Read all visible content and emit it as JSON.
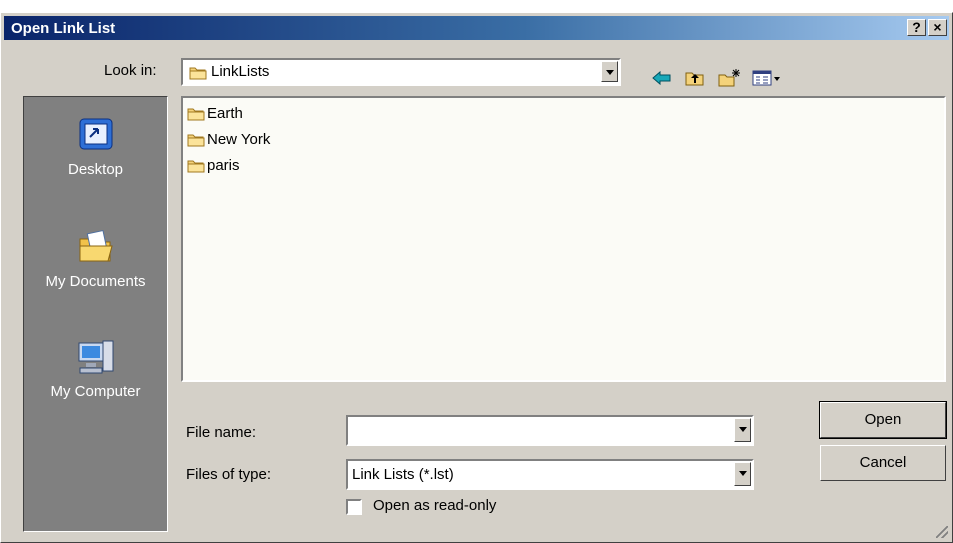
{
  "window": {
    "title": "Open Link List",
    "help_button": "?",
    "close_button": "×"
  },
  "look_in": {
    "label": "Look in:",
    "value": "LinkLists"
  },
  "toolbar": {
    "icons": [
      "back-icon",
      "up-folder-icon",
      "new-folder-icon",
      "view-menu-icon"
    ]
  },
  "places": [
    {
      "label": "Desktop",
      "icon": "desktop-icon"
    },
    {
      "label": "My Documents",
      "icon": "my-documents-icon"
    },
    {
      "label": "My Computer",
      "icon": "my-computer-icon"
    }
  ],
  "files": [
    {
      "name": "Earth",
      "type": "folder"
    },
    {
      "name": "New York",
      "type": "folder"
    },
    {
      "name": "paris",
      "type": "folder"
    }
  ],
  "file_name": {
    "label": "File name:",
    "value": ""
  },
  "file_type": {
    "label": "Files of type:",
    "value": "Link Lists (*.lst)"
  },
  "read_only": {
    "label": "Open as read-only",
    "checked": false
  },
  "buttons": {
    "open": "Open",
    "cancel": "Cancel"
  },
  "colors": {
    "titlebar_start": "#0a246a",
    "titlebar_end": "#a6caf0",
    "places_bar": "#808080",
    "dialog_face": "#d4d0c8"
  }
}
